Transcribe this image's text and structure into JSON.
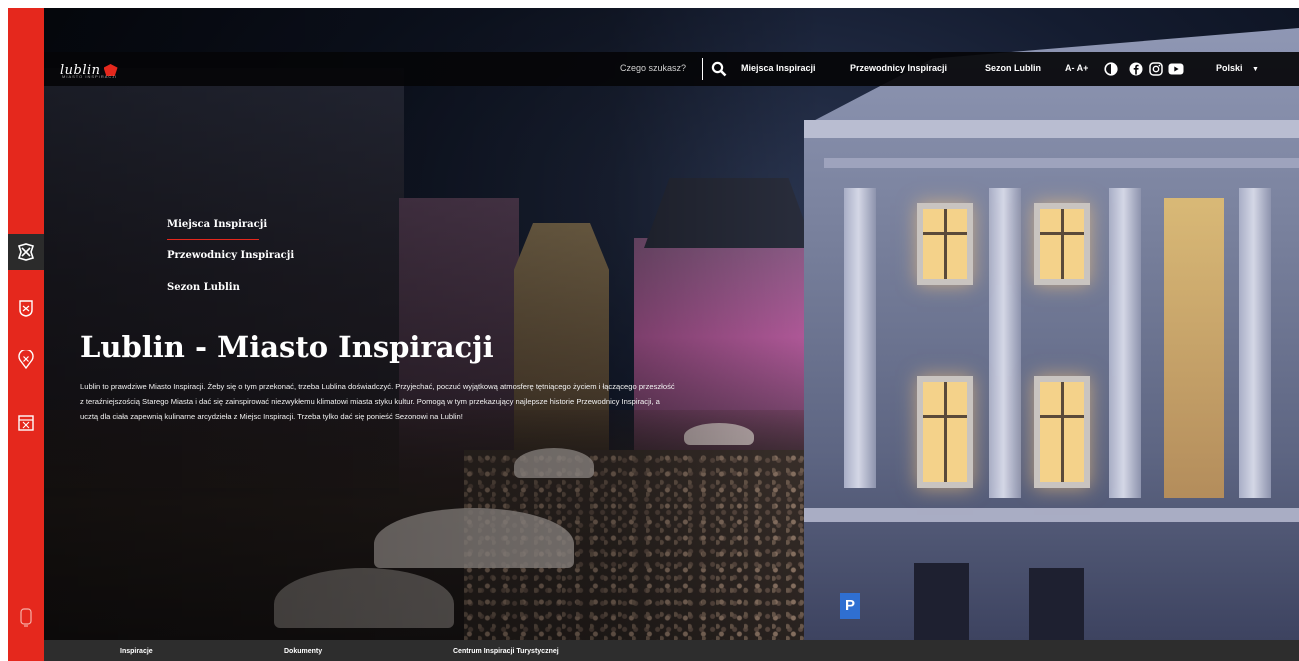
{
  "header": {
    "logo_text": "lublin",
    "logo_subtitle": "MIASTO INSPIRACJI",
    "search_placeholder": "Czego szukasz?",
    "nav": [
      "Miejsca Inspiracji",
      "Przewodnicy Inspiracji",
      "Sezon Lublin"
    ],
    "font_controls": "A- A+",
    "language": "Polski",
    "icons": [
      "search-icon",
      "contrast-icon",
      "facebook-icon",
      "instagram-icon",
      "youtube-icon",
      "caret-down-icon"
    ]
  },
  "sidebar": {
    "icons": [
      "lublin-emblem-icon",
      "shield-icon",
      "map-pin-icon",
      "calendar-icon",
      "phone-icon"
    ],
    "accent_color": "#e5281d"
  },
  "hero": {
    "submenu": [
      "Miejsca Inspiracji",
      "Przewodnicy Inspiracji",
      "Sezon Lublin"
    ],
    "title": "Lublin - Miasto Inspiracji",
    "description": "Lublin to prawdziwe Miasto Inspiracji. Żeby się o tym przekonać, trzeba Lublina doświadczyć. Przyjechać, poczuć wyjątkową atmosferę tętniącego życiem i łączącego przeszłość z teraźniejszością Starego Miasta i dać się zainspirować niezwykłemu klimatowi miasta styku kultur. Pomogą w tym przekazujący najlepsze historie Przewodnicy Inspiracji, a ucztą dla ciała zapewnią kulinarne arcydzieła z Miejsc Inspiracji. Trzeba tylko dać się ponieść Sezonowi na Lublin!"
  },
  "footer": {
    "links": [
      "Inspiracje",
      "Dokumenty",
      "Centrum Inspiracji Turystycznej"
    ]
  }
}
